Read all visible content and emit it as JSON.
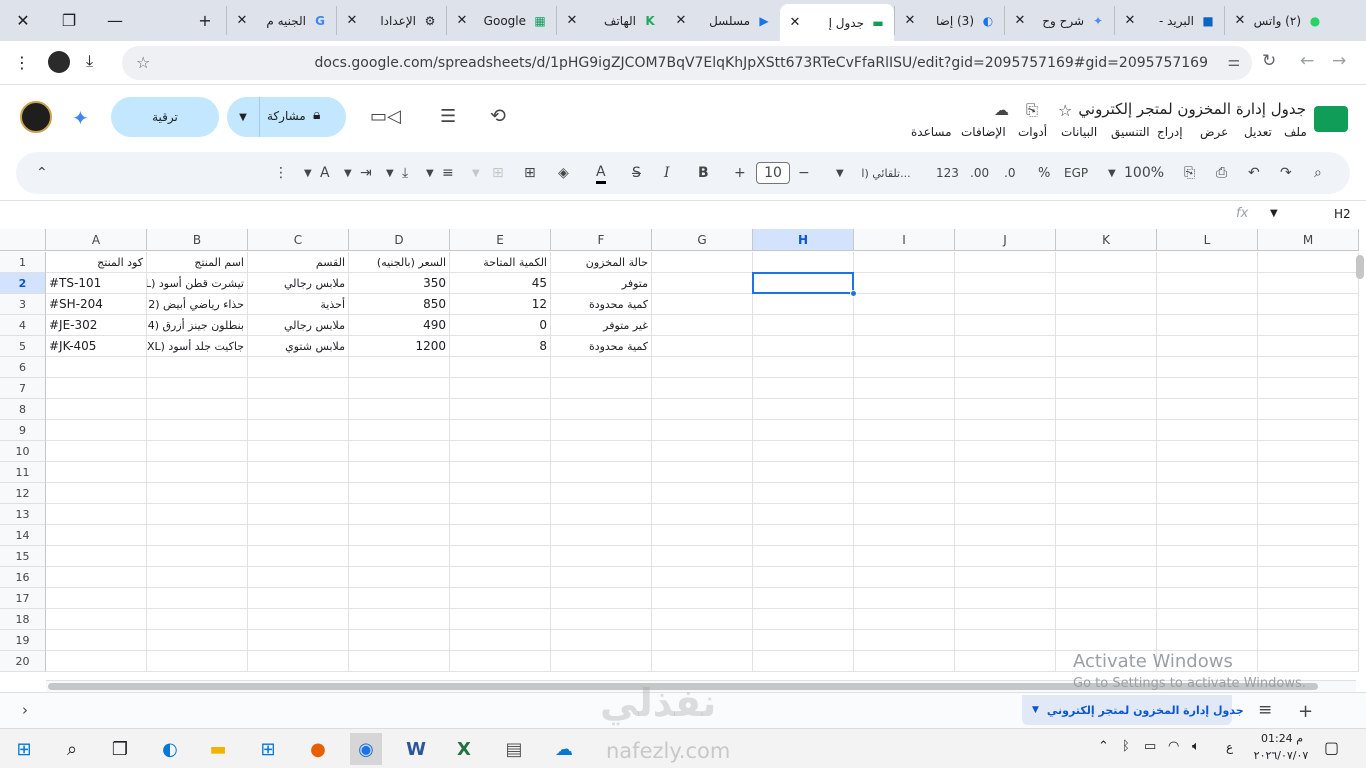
{
  "browser": {
    "tabs": [
      {
        "label": "(٢) واتس",
        "icon": "whatsapp-icon"
      },
      {
        "label": "البريد -",
        "icon": "outlook-icon"
      },
      {
        "label": "شرح وح",
        "icon": "gemini-icon"
      },
      {
        "label": "(3) إضا",
        "icon": "edge-icon"
      },
      {
        "label": "جدول إ",
        "icon": "sheets-icon",
        "active": true
      },
      {
        "label": "مسلسل",
        "icon": "play-icon"
      },
      {
        "label": "الهاتف",
        "icon": "k-icon"
      },
      {
        "label": "Google",
        "icon": "sheets-green-icon"
      },
      {
        "label": "الإعدادا",
        "icon": "gear-icon"
      },
      {
        "label": "الجنيه م",
        "icon": "google-icon"
      }
    ],
    "url": "docs.google.com/spreadsheets/d/1pHG9igZJCOM7BqV7ElqKhJpXStt673RTeCvFfaRlISU/edit?gid=2095757169#gid=2095757169"
  },
  "doc": {
    "title": "جدول إدارة المخزون لمتجر إلكتروني",
    "menu": [
      "ملف",
      "تعديل",
      "عرض",
      "إدراج",
      "التنسيق",
      "البيانات",
      "أدوات",
      "الإضافات",
      "مساعدة"
    ],
    "share_label": "مشاركة",
    "upgrade_label": "ترقية"
  },
  "toolbar": {
    "zoom": "100%",
    "currency": "EGP",
    "percent": "%",
    "dec_less": ".0",
    "dec_more": ".00",
    "number_format": "123",
    "font": "تلقائي (ا...",
    "font_size": "10",
    "minus": "−",
    "plus": "+",
    "bold": "B",
    "italic": "I"
  },
  "formula_bar": {
    "cell_ref": "H2",
    "fx": "fx"
  },
  "columns": [
    "A",
    "B",
    "C",
    "D",
    "E",
    "F",
    "G",
    "H",
    "I",
    "J",
    "K",
    "L",
    "M"
  ],
  "selected_column": "H",
  "rows": [
    "1",
    "2",
    "3",
    "4",
    "5",
    "6",
    "7",
    "8",
    "9",
    "10",
    "11",
    "12",
    "13",
    "14",
    "15",
    "16",
    "17",
    "18",
    "19",
    "20"
  ],
  "selected_row": "2",
  "table": {
    "headers": [
      "كود المنتج",
      "اسم المنتج",
      "القسم",
      "السعر (بالجنيه)",
      "الكمية المتاحة",
      "حالة المخزون"
    ],
    "data": [
      [
        "#TS-101",
        "تيشرت قطن أسود (L)",
        "ملابس رجالي",
        "350",
        "45",
        "متوفر"
      ],
      [
        "#SH-204",
        "حذاء رياضي أبيض (2",
        "أحذية",
        "850",
        "12",
        "كمية محدودة"
      ],
      [
        "#JE-302",
        "بنطلون جينز أزرق (4",
        "ملابس رجالي",
        "490",
        "0",
        "غير متوفر"
      ],
      [
        "#JK-405",
        "جاكيت جلد أسود (XL)",
        "ملابس شتوي",
        "1200",
        "8",
        "كمية محدودة"
      ]
    ]
  },
  "sheet_tab": "جدول إدارة المخزون لمتجر إلكتروني",
  "watermark": {
    "brand": "نفذلي",
    "site": "nafezly.com",
    "activate_title": "Activate Windows",
    "activate_sub": "Go to Settings to activate Windows."
  },
  "taskbar": {
    "time": "01:24 م",
    "date": "٢٠٢٦/٠٧/٠٧",
    "lang": "ع"
  }
}
